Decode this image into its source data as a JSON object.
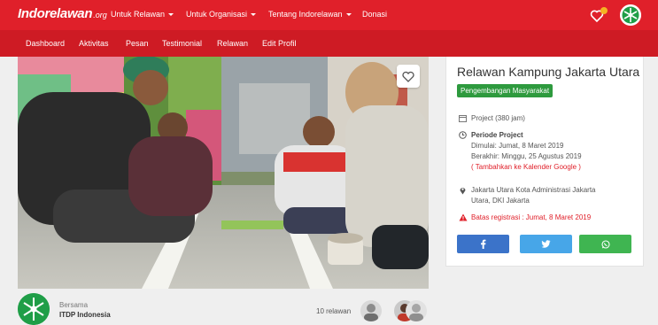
{
  "brand": {
    "name": "Indorelawan",
    "tld": ".org"
  },
  "nav": {
    "items": [
      {
        "label": "Untuk Relawan",
        "has_caret": true
      },
      {
        "label": "Untuk Organisasi",
        "has_caret": true
      },
      {
        "label": "Tentang Indorelawan",
        "has_caret": true
      },
      {
        "label": "Donasi",
        "has_caret": false
      }
    ],
    "icons": [
      "heart-icon",
      "notification-badge-icon",
      "user-avatar-logo"
    ]
  },
  "subnav": {
    "items": [
      "Dashboard",
      "Aktivitas",
      "Pesan",
      "Testimonial",
      "Relawan",
      "Edit Profil"
    ]
  },
  "activity": {
    "title": "Relawan Kampung Jakarta Utara",
    "category": "Pengembangan Masyarakat",
    "project_type": "Project (380 jam)",
    "period_label": "Periode Project",
    "start": "Dimulai: Jumat, 8 Maret 2019",
    "end": "Berakhir: Minggu, 25 Agustus 2019",
    "calendar_link": "( Tambahkan ke Kalender Google )",
    "location_line1": "Jakarta Utara Kota Administrasi Jakarta",
    "location_line2": "Utara, DKI Jakarta",
    "registration_deadline": "Batas registrasi : Jumat, 8 Maret 2019"
  },
  "share": {
    "facebook": "f",
    "twitter": "t",
    "whatsapp": "w"
  },
  "host": {
    "with_label": "Bersama",
    "name": "ITDP Indonesia"
  },
  "volunteers": {
    "count_label": "10 relawan"
  },
  "colors": {
    "nav_red": "#e0202a",
    "subnav_red": "#ce1b24",
    "category_green": "#2e9a3e",
    "facebook": "#3b73c9",
    "twitter": "#47a6e8",
    "whatsapp": "#3fb551"
  }
}
